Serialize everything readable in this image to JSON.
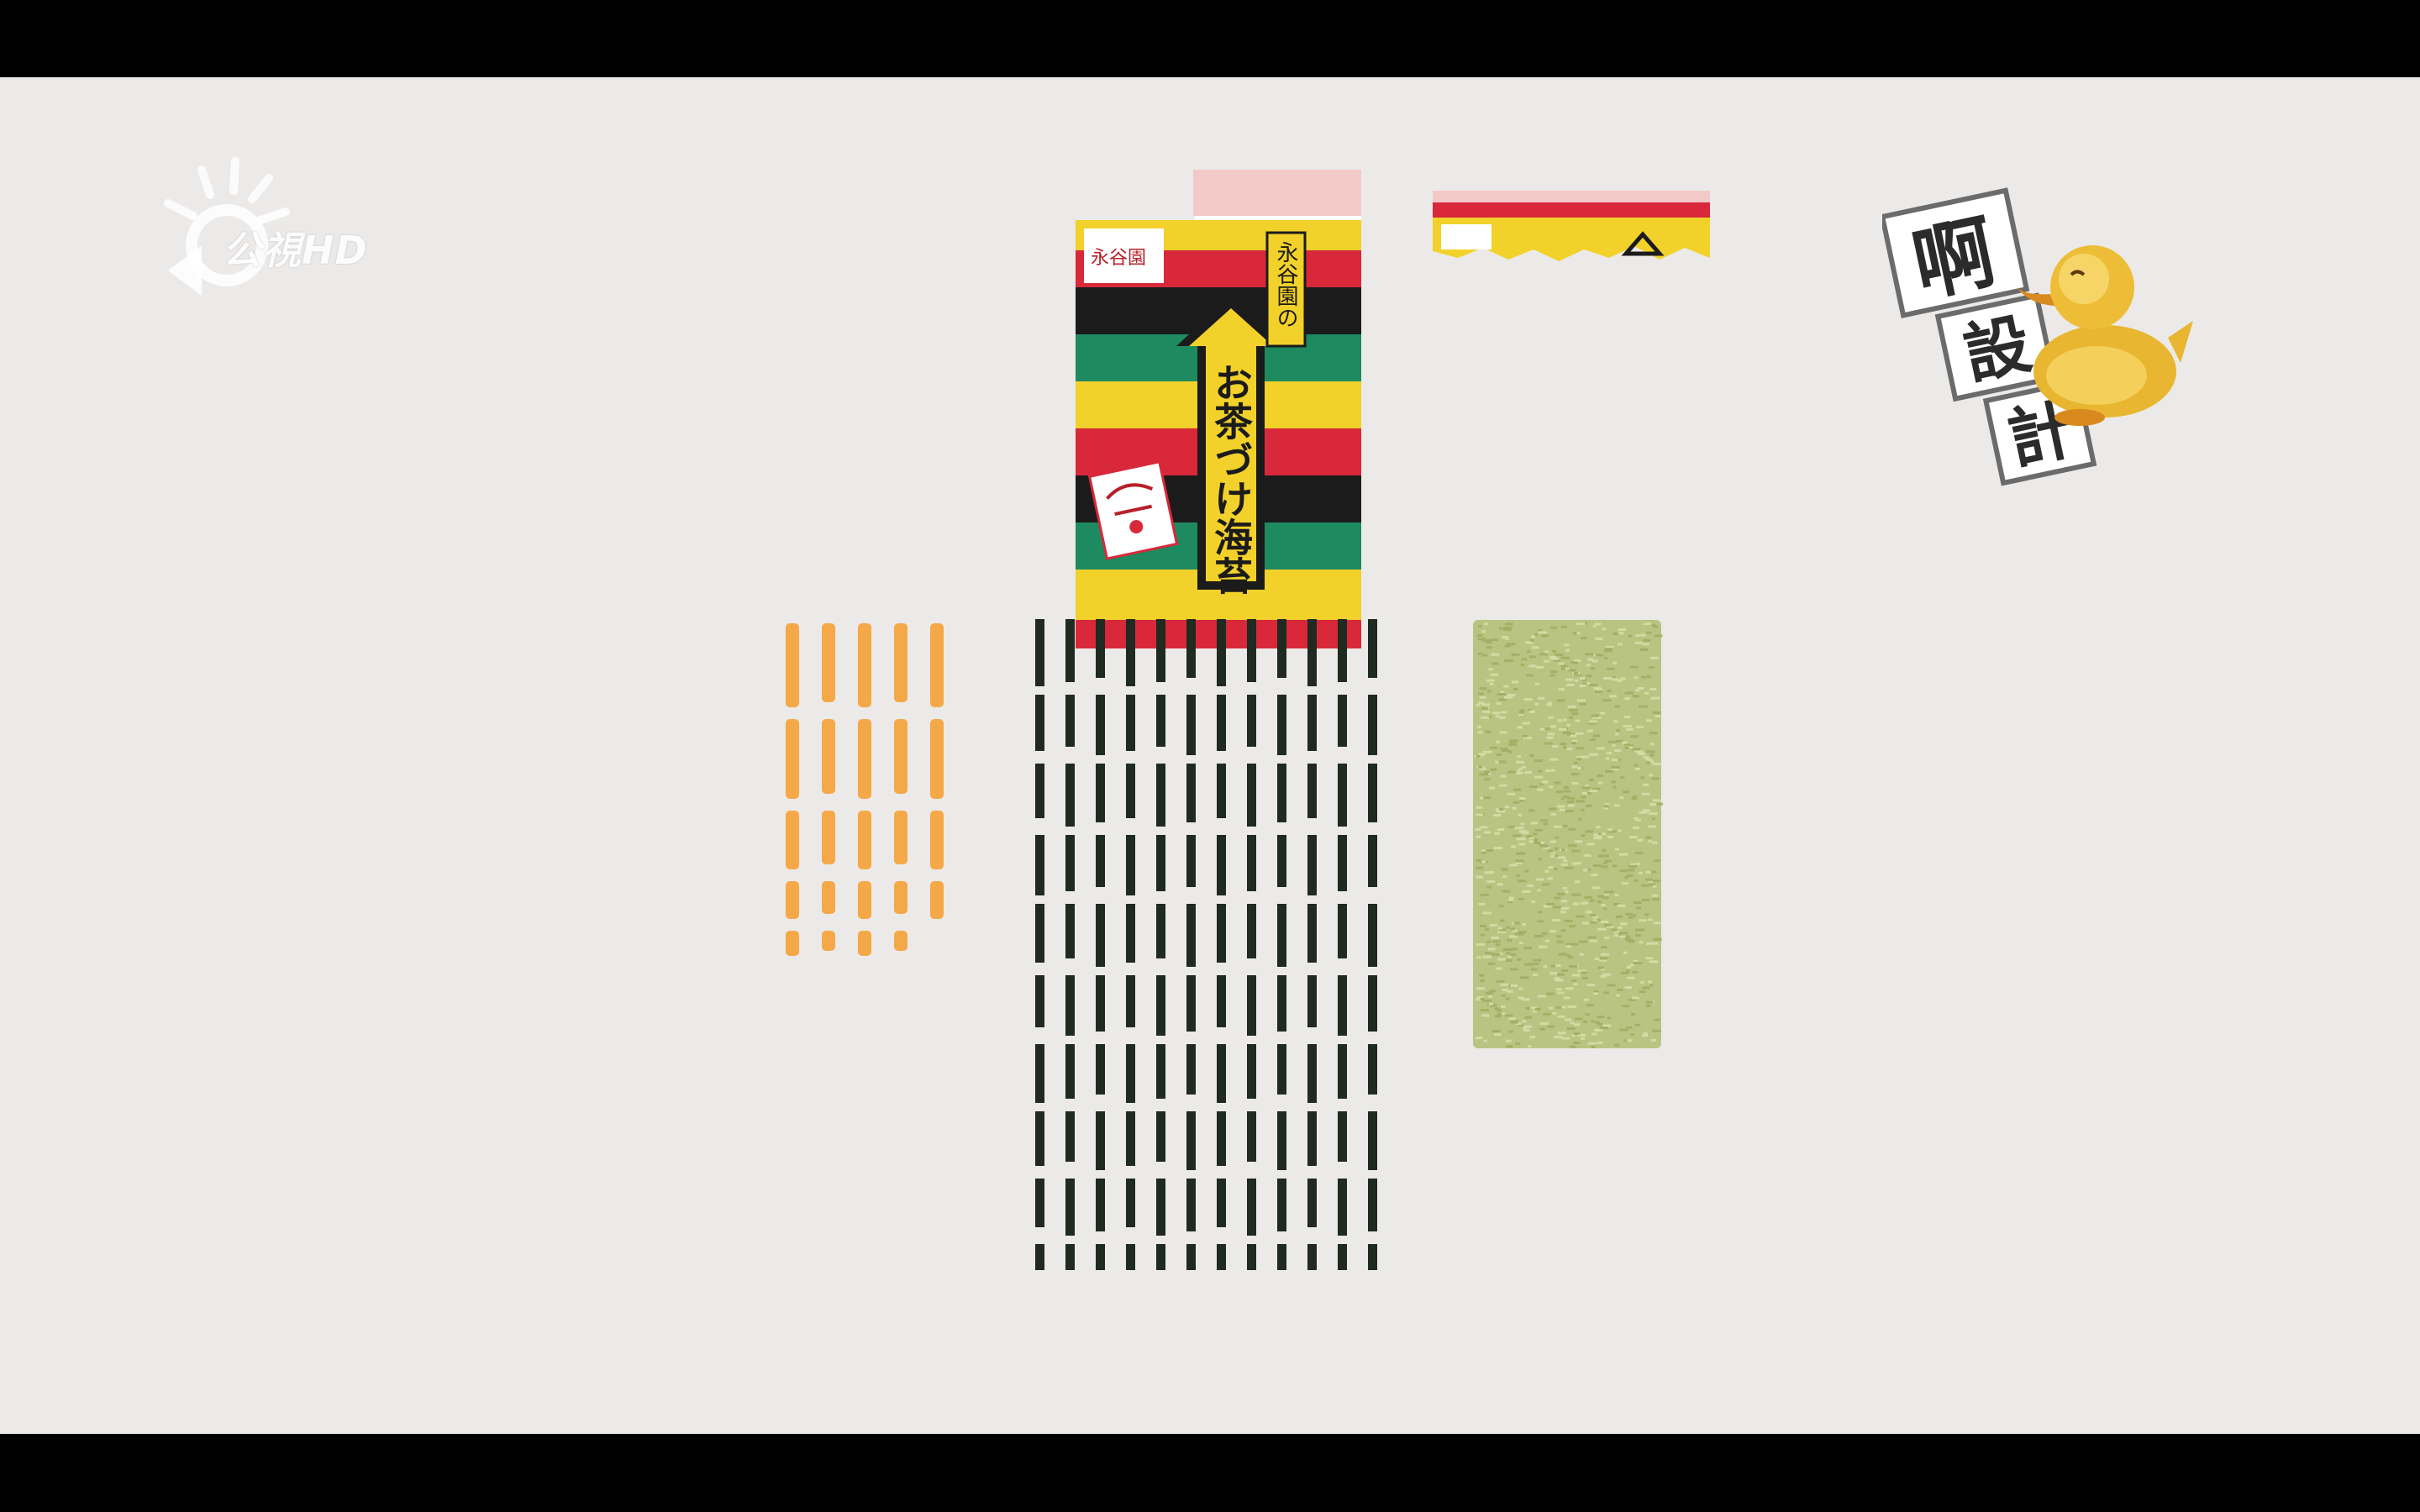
{
  "overlay": {
    "channel_logo": {
      "label": "公視HD"
    },
    "show_logo": {
      "title_chars": [
        "啊",
        "設",
        "計"
      ]
    }
  },
  "scene": {
    "package": {
      "brand": "永谷園",
      "brand_vertical": "永谷園の",
      "product_name": "お茶づけ海苔"
    }
  },
  "colors": {
    "background": "#eceae8",
    "letterbox": "#000000",
    "stripe_red": "#d8283a",
    "stripe_green": "#1d8a5f",
    "stripe_yellow": "#f2d12a",
    "stripe_black": "#1b1b1b",
    "carrot": "#f4a847",
    "seaweed": "#1f2a20",
    "rice_cracker": "#b9c482",
    "duck": "#e8b630"
  }
}
